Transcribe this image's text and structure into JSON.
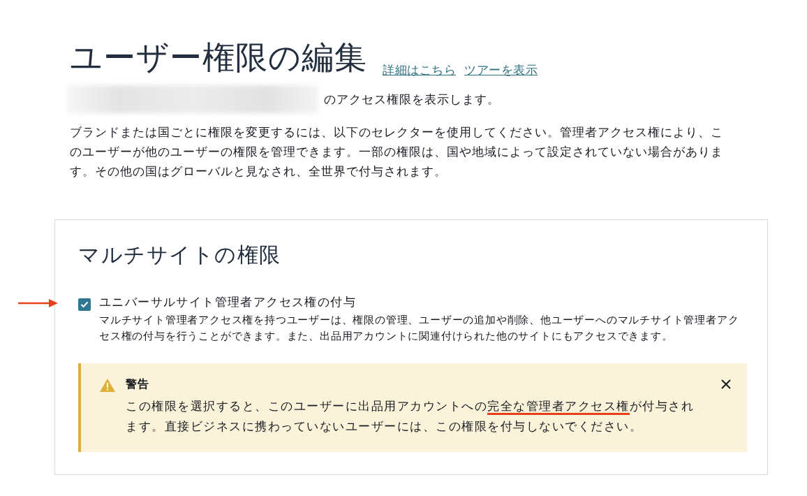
{
  "header": {
    "title": "ユーザー権限の編集",
    "links": [
      "詳細はこちら",
      "ツアーを表示"
    ]
  },
  "intro": {
    "redacted": true,
    "text": "のアクセス権限を表示します。"
  },
  "description": "ブランドまたは国ごとに権限を変更するには、以下のセレクターを使用してください。管理者アクセス権により、このユーザーが他のユーザーの権限を管理できます。一部の権限は、国や地域によって設定されていない場合があります。その他の国はグローバルと見なされ、全世界で付与されます。",
  "section": {
    "title": "マルチサイトの権限",
    "option": {
      "label": "ユニバーサルサイト管理者アクセス権の付与",
      "checked": true,
      "annotated": true,
      "help": "マルチサイト管理者アクセス権を持つユーザーは、権限の管理、ユーザーの追加や削除、他ユーザーへのマルチサイト管理者アクセス権の付与を行うことができます。また、出品用アカウントに関連付けられた他のサイトにもアクセスできます。"
    },
    "alert": {
      "kind": "warning",
      "title": "警告",
      "before": "この権限を選択すると、このユーザーに出品用アカウントへの",
      "highlight": "完全な管理者アクセス権",
      "after": "が付与されます。直接ビジネスに携わっていないユーザーには、この権限を付与しないでください。"
    }
  }
}
